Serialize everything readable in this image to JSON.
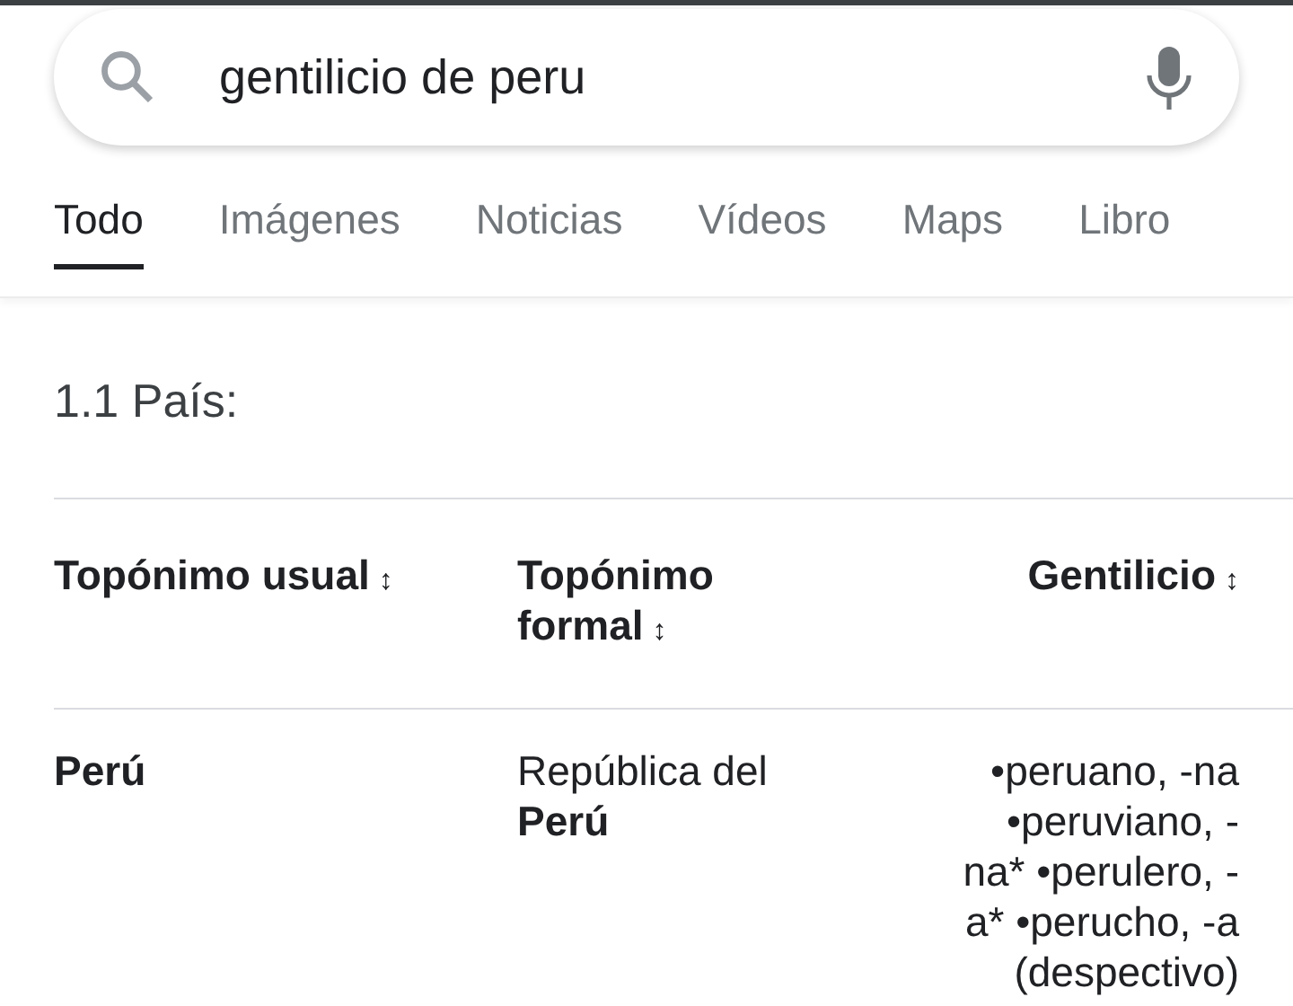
{
  "search": {
    "value": "gentilicio de peru"
  },
  "tabs": [
    {
      "label": "Todo",
      "selected": true
    },
    {
      "label": "Imágenes",
      "selected": false
    },
    {
      "label": "Noticias",
      "selected": false
    },
    {
      "label": "Vídeos",
      "selected": false
    },
    {
      "label": "Maps",
      "selected": false
    },
    {
      "label": "Libro",
      "selected": false
    }
  ],
  "section_heading": "1.1 País:",
  "table": {
    "columns": [
      {
        "label": "Topónimo usual",
        "sort": "↕"
      },
      {
        "label": "Topónimo formal",
        "sort": "↕"
      },
      {
        "label": "Gentilicio",
        "sort": "↕"
      }
    ],
    "rows": [
      {
        "cells": [
          {
            "text": "**Perú**"
          },
          {
            "text": "República del **Perú**"
          },
          {
            "text": "•peruano, -na •peruviano, -na* •perulero, -a* •perucho, -a (despectivo)"
          }
        ]
      }
    ]
  }
}
